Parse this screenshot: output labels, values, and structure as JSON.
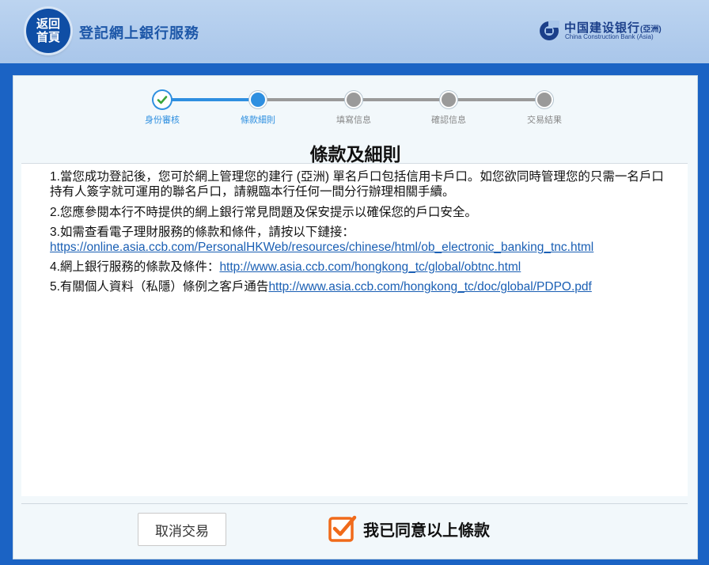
{
  "header": {
    "home_line1": "返回",
    "home_line2": "首頁",
    "title": "登記網上銀行服務",
    "logo_cn": "中国建设银行",
    "logo_region": "(亞洲)",
    "logo_en": "China Construction Bank (Asia)"
  },
  "steps": [
    {
      "label": "身份審核",
      "state": "done"
    },
    {
      "label": "條款細則",
      "state": "current"
    },
    {
      "label": "填寫信息",
      "state": "todo"
    },
    {
      "label": "確認信息",
      "state": "todo"
    },
    {
      "label": "交易結果",
      "state": "todo"
    }
  ],
  "content": {
    "title": "條款及細則",
    "item1": "1.當您成功登記後，您可於網上管理您的建行 (亞洲) 單名戶口包括信用卡戶口。如您欲同時管理您的只需一名戶口持有人簽字就可運用的聯名戶口，請親臨本行任何一間分行辦理相關手續。",
    "item2": "2.您應參閱本行不時提供的網上銀行常見問題及保安提示以確保您的戶口安全。",
    "item3_text": "3.如需查看電子理財服務的條款和條件，請按以下鏈接：",
    "item3_link": "https://online.asia.ccb.com/PersonalHKWeb/resources/chinese/html/ob_electronic_banking_tnc.html",
    "item4_text": "4.網上銀行服務的條款及條件：",
    "item4_link": "http://www.asia.ccb.com/hongkong_tc/global/obtnc.html",
    "item5_text": "5.有關個人資料（私隱）條例之客戶通告",
    "item5_link": "http://www.asia.ccb.com/hongkong_tc/doc/global/PDPO.pdf"
  },
  "footer": {
    "cancel_label": "取消交易",
    "agree_label": "我已同意以上條款"
  },
  "colors": {
    "brand_blue": "#1b63c4",
    "progress_active": "#2e8fe0",
    "progress_inactive": "#9a9a9a",
    "checkbox_orange": "#f06a1a"
  }
}
